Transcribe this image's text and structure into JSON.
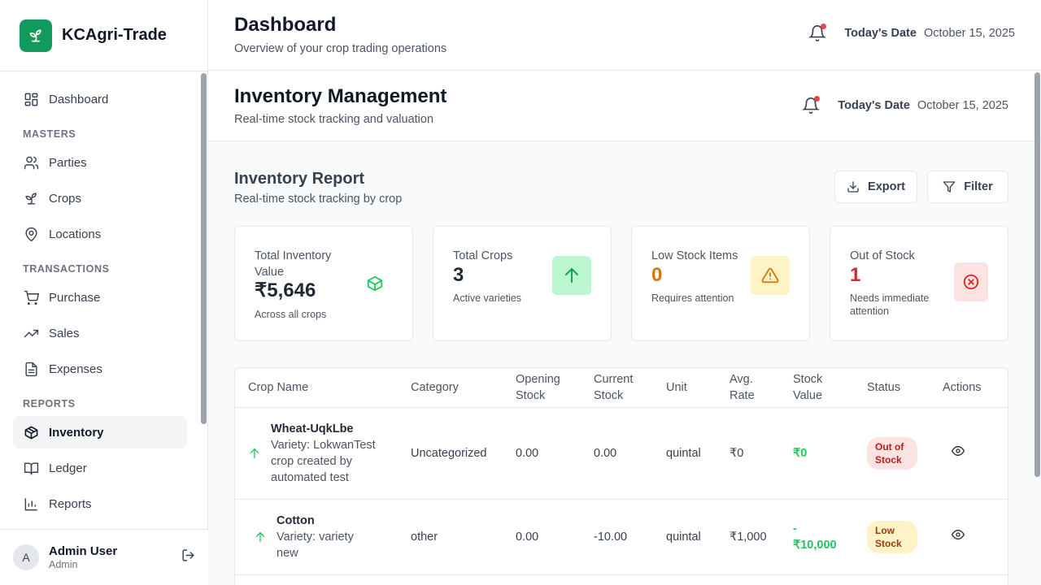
{
  "app": {
    "name": "KCAgri-Trade"
  },
  "sidebar": {
    "items": [
      {
        "label": "Dashboard",
        "icon": "grid-icon"
      },
      {
        "section": "MASTERS"
      },
      {
        "label": "Parties",
        "icon": "users-icon"
      },
      {
        "label": "Crops",
        "icon": "sprout-icon"
      },
      {
        "label": "Locations",
        "icon": "map-pin-icon"
      },
      {
        "section": "TRANSACTIONS"
      },
      {
        "label": "Purchase",
        "icon": "cart-icon"
      },
      {
        "label": "Sales",
        "icon": "trending-up-icon"
      },
      {
        "label": "Expenses",
        "icon": "file-text-icon"
      },
      {
        "section": "REPORTS"
      },
      {
        "label": "Inventory",
        "icon": "package-icon",
        "active": true
      },
      {
        "label": "Ledger",
        "icon": "book-open-icon"
      },
      {
        "label": "Reports",
        "icon": "bar-chart-icon"
      }
    ],
    "sections": {
      "masters": "MASTERS",
      "transactions": "TRANSACTIONS",
      "reports": "REPORTS"
    },
    "labels": {
      "dashboard": "Dashboard",
      "parties": "Parties",
      "crops": "Crops",
      "locations": "Locations",
      "purchase": "Purchase",
      "sales": "Sales",
      "expenses": "Expenses",
      "inventory": "Inventory",
      "ledger": "Ledger",
      "reports": "Reports"
    }
  },
  "user": {
    "initial": "A",
    "name": "Admin User",
    "role": "Admin"
  },
  "header": {
    "title": "Dashboard",
    "subtitle": "Overview of your crop trading operations",
    "date_label": "Today's Date",
    "date_value": "October 15, 2025"
  },
  "subheader": {
    "title": "Inventory Management",
    "subtitle": "Real-time stock tracking and valuation",
    "date_label": "Today's Date",
    "date_value": "October 15, 2025"
  },
  "report": {
    "title": "Inventory Report",
    "subtitle": "Real-time stock tracking by crop",
    "export_label": "Export",
    "filter_label": "Filter"
  },
  "cards": {
    "total_value": {
      "title": "Total Inventory Value",
      "value": "₹5,646",
      "note": "Across all crops",
      "icon": "package-icon",
      "color": "#22c55e"
    },
    "total_crops": {
      "title": "Total Crops",
      "value": "3",
      "note": "Active varieties",
      "icon": "arrow-up-icon",
      "color": "#16a34a"
    },
    "low_stock": {
      "title": "Low Stock Items",
      "value": "0",
      "note": "Requires attention",
      "icon": "warning-icon",
      "color": "#d97706"
    },
    "out_of_stock": {
      "title": "Out of Stock",
      "value": "1",
      "note": "Needs immediate attention",
      "icon": "x-circle-icon",
      "color": "#dc2626"
    }
  },
  "table": {
    "headers": [
      "Crop Name",
      "Category",
      "Opening Stock",
      "Current Stock",
      "Unit",
      "Avg. Rate",
      "Stock Value",
      "Status",
      "Actions"
    ],
    "rows": [
      {
        "name": "Wheat-UqkLbe",
        "variety": "Variety: LokwanTest crop created by automated test",
        "category": "Uncategorized",
        "opening": "0.00",
        "current": "0.00",
        "unit": "quintal",
        "rate": "₹0",
        "value": "₹0",
        "status": "Out of Stock"
      },
      {
        "name": "Cotton",
        "variety": "Variety: variety new",
        "category": "other",
        "opening": "0.00",
        "current": "-10.00",
        "unit": "quintal",
        "rate": "₹1,000",
        "value": "-₹10,000",
        "value_lines": [
          "-",
          "₹10,000"
        ],
        "status": "Low Stock"
      }
    ]
  }
}
